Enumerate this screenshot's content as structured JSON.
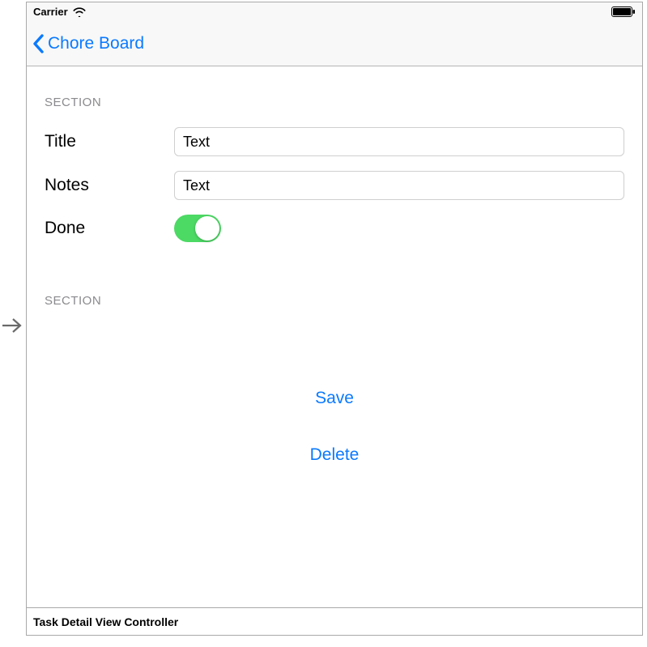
{
  "status_bar": {
    "carrier": "Carrier"
  },
  "nav": {
    "back_label": "Chore Board"
  },
  "section1": {
    "header": "SECTION",
    "title_label": "Title",
    "title_value": "Text",
    "notes_label": "Notes",
    "notes_value": "Text",
    "done_label": "Done",
    "done_on": true
  },
  "section2": {
    "header": "SECTION",
    "save_label": "Save",
    "delete_label": "Delete"
  },
  "footer": {
    "scene_name": "Task Detail View Controller"
  }
}
